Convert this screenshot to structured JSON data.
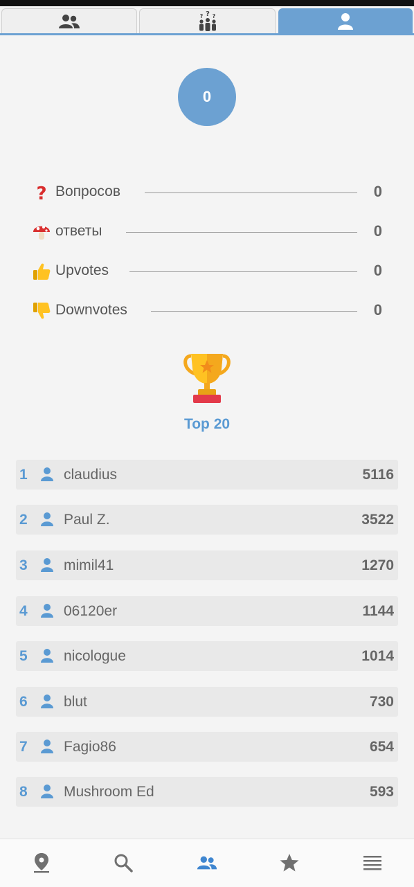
{
  "tabs": [
    {
      "icon": "people-icon",
      "active": false
    },
    {
      "icon": "group-question-icon",
      "active": false
    },
    {
      "icon": "person-icon",
      "active": true
    }
  ],
  "score": "0",
  "stats": [
    {
      "icon": "question-mark-icon",
      "label": "Вопросов",
      "value": "0"
    },
    {
      "icon": "mushroom-icon",
      "label": "ответы",
      "value": "0"
    },
    {
      "icon": "thumbs-up-icon",
      "label": "Upvotes",
      "value": "0"
    },
    {
      "icon": "thumbs-down-icon",
      "label": "Downvotes",
      "value": "0"
    }
  ],
  "leaderboard": {
    "title": "Top 20",
    "rows": [
      {
        "rank": "1",
        "name": "claudius",
        "points": "5116"
      },
      {
        "rank": "2",
        "name": "Paul Z.",
        "points": "3522"
      },
      {
        "rank": "3",
        "name": "mimil41",
        "points": "1270"
      },
      {
        "rank": "4",
        "name": "06120er",
        "points": "1144"
      },
      {
        "rank": "5",
        "name": "nicologue",
        "points": "1014"
      },
      {
        "rank": "6",
        "name": "blut",
        "points": "730"
      },
      {
        "rank": "7",
        "name": "Fagio86",
        "points": "654"
      },
      {
        "rank": "8",
        "name": "Mushroom Ed",
        "points": "593"
      }
    ]
  },
  "bottom_nav": [
    {
      "icon": "map-pin-icon",
      "active": false
    },
    {
      "icon": "search-icon",
      "active": false
    },
    {
      "icon": "community-icon",
      "active": true
    },
    {
      "icon": "star-icon",
      "active": false
    },
    {
      "icon": "menu-icon",
      "active": false
    }
  ],
  "colors": {
    "accent": "#6ca1d2",
    "rank": "#5a9ad3",
    "inactive_icon": "#707070"
  }
}
